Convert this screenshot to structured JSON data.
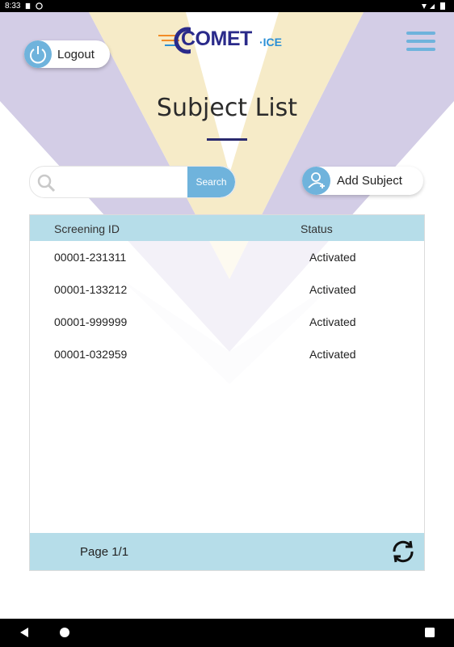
{
  "status_bar": {
    "time": "8:33"
  },
  "header": {
    "logout_label": "Logout",
    "logo_word": "COMET",
    "logo_suffix": "·ICE"
  },
  "page": {
    "title": "Subject List"
  },
  "search": {
    "value": "",
    "placeholder": "",
    "button_label": "Search"
  },
  "add_subject_label": "Add Subject",
  "table": {
    "columns": [
      "Screening ID",
      "Status"
    ],
    "rows": [
      {
        "id": "00001-231311",
        "status": "Activated"
      },
      {
        "id": "00001-133212",
        "status": "Activated"
      },
      {
        "id": "00001-999999",
        "status": "Activated"
      },
      {
        "id": "00001-032959",
        "status": "Activated"
      }
    ],
    "page_label": "Page 1/1"
  },
  "colors": {
    "accent": "#6fb3dc",
    "table_header": "#b6dde9",
    "deco_purple": "#d3cde6",
    "deco_yellow": "#f6ebc8"
  },
  "icons": {
    "logout": "power-icon",
    "menu": "hamburger-menu-icon",
    "search": "search-icon",
    "add": "add-user-icon",
    "refresh": "refresh-icon"
  }
}
